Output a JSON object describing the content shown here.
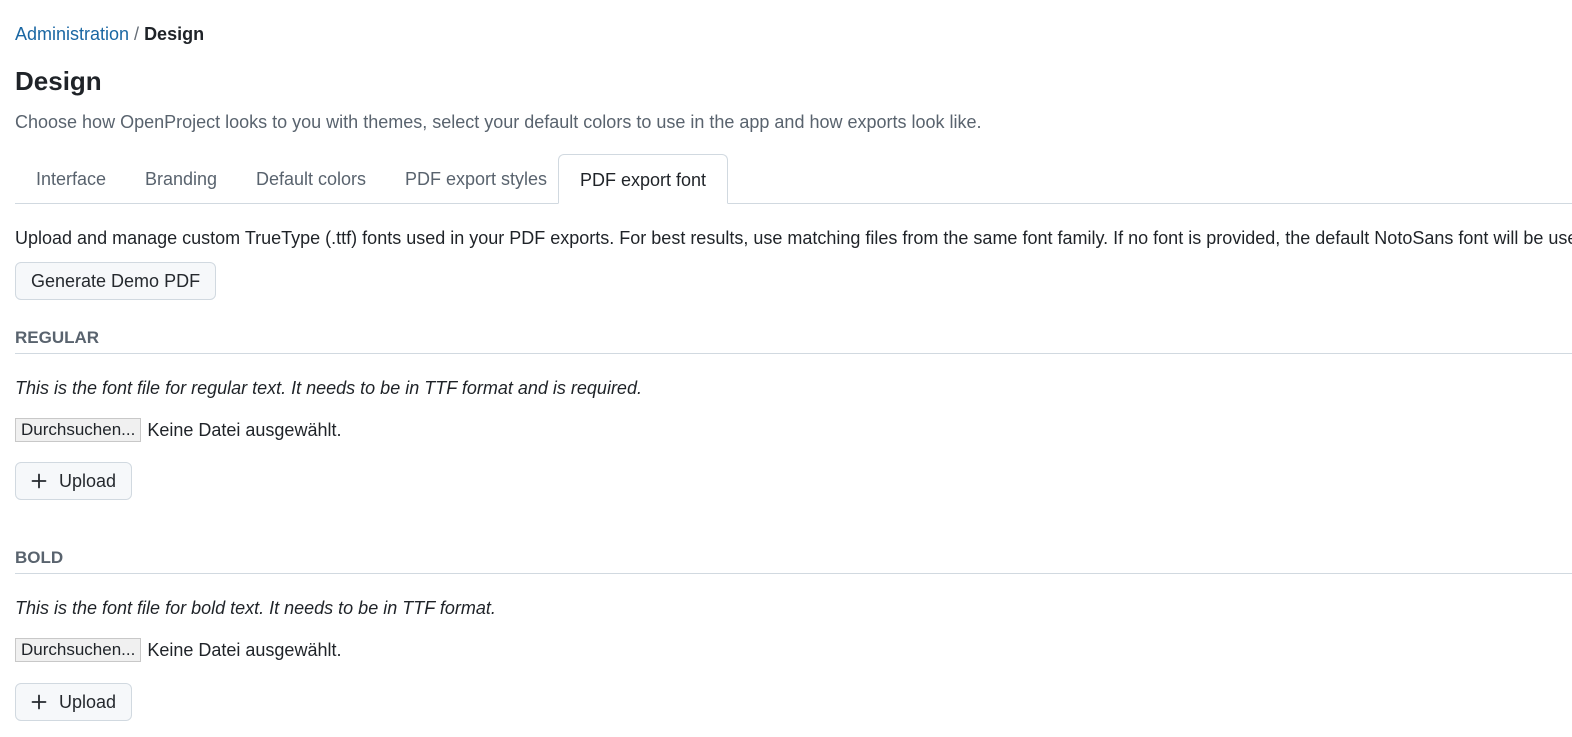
{
  "breadcrumb": {
    "parent": "Administration",
    "separator": "/",
    "current": "Design"
  },
  "page": {
    "title": "Design",
    "description": "Choose how OpenProject looks to you with themes, select your default colors to use in the app and how exports look like."
  },
  "tabs": [
    {
      "label": "Interface",
      "selected": false
    },
    {
      "label": "Branding",
      "selected": false
    },
    {
      "label": "Default colors",
      "selected": false
    },
    {
      "label": "PDF export styles",
      "selected": false
    },
    {
      "label": "PDF export font",
      "selected": true
    }
  ],
  "content": {
    "intro": "Upload and manage custom TrueType (.ttf) fonts used in your PDF exports. For best results, use matching files from the same font family. If no font is provided, the default NotoSans font will be used.",
    "demo_button": "Generate Demo PDF",
    "sections": [
      {
        "heading": "REGULAR",
        "note": "This is the font file for regular text. It needs to be in TTF format and is required.",
        "browse_label": "Durchsuchen...",
        "file_status": "Keine Datei ausgewählt.",
        "upload_label": "Upload",
        "upload_icon": "plus-icon"
      },
      {
        "heading": "BOLD",
        "note": "This is the font file for bold text. It needs to be in TTF format.",
        "browse_label": "Durchsuchen...",
        "file_status": "Keine Datei ausgewählt.",
        "upload_label": "Upload",
        "upload_icon": "plus-icon"
      }
    ]
  },
  "colors": {
    "link": "#1a67a3",
    "muted_text": "#59636e",
    "border": "#d1d9e0",
    "button_bg": "#f6f8fa"
  }
}
